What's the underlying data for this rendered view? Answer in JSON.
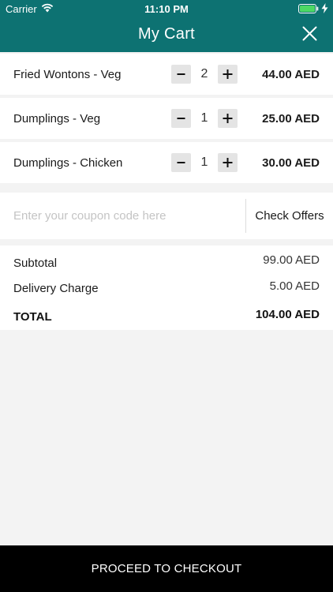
{
  "status_bar": {
    "carrier": "Carrier",
    "time": "11:10 PM",
    "wifi_icon": "wifi-icon",
    "battery_icon": "battery-icon"
  },
  "header": {
    "title": "My Cart",
    "close_icon": "close-icon",
    "background_color": "#0d7272"
  },
  "cart_items": [
    {
      "name": "Fried Wontons - Veg",
      "quantity": "2",
      "price": "44.00 AED"
    },
    {
      "name": "Dumplings - Veg",
      "quantity": "1",
      "price": "25.00 AED"
    },
    {
      "name": "Dumplings - Chicken",
      "quantity": "1",
      "price": "30.00 AED"
    }
  ],
  "coupon": {
    "placeholder": "Enter your coupon code here",
    "value": "",
    "check_offers_label": "Check Offers"
  },
  "summary": {
    "subtotal_label": "Subtotal",
    "subtotal_value": "99.00 AED",
    "delivery_label": "Delivery Charge",
    "delivery_value": "5.00 AED",
    "total_label": "TOTAL",
    "total_value": "104.00 AED"
  },
  "checkout": {
    "label": "PROCEED TO CHECKOUT"
  }
}
